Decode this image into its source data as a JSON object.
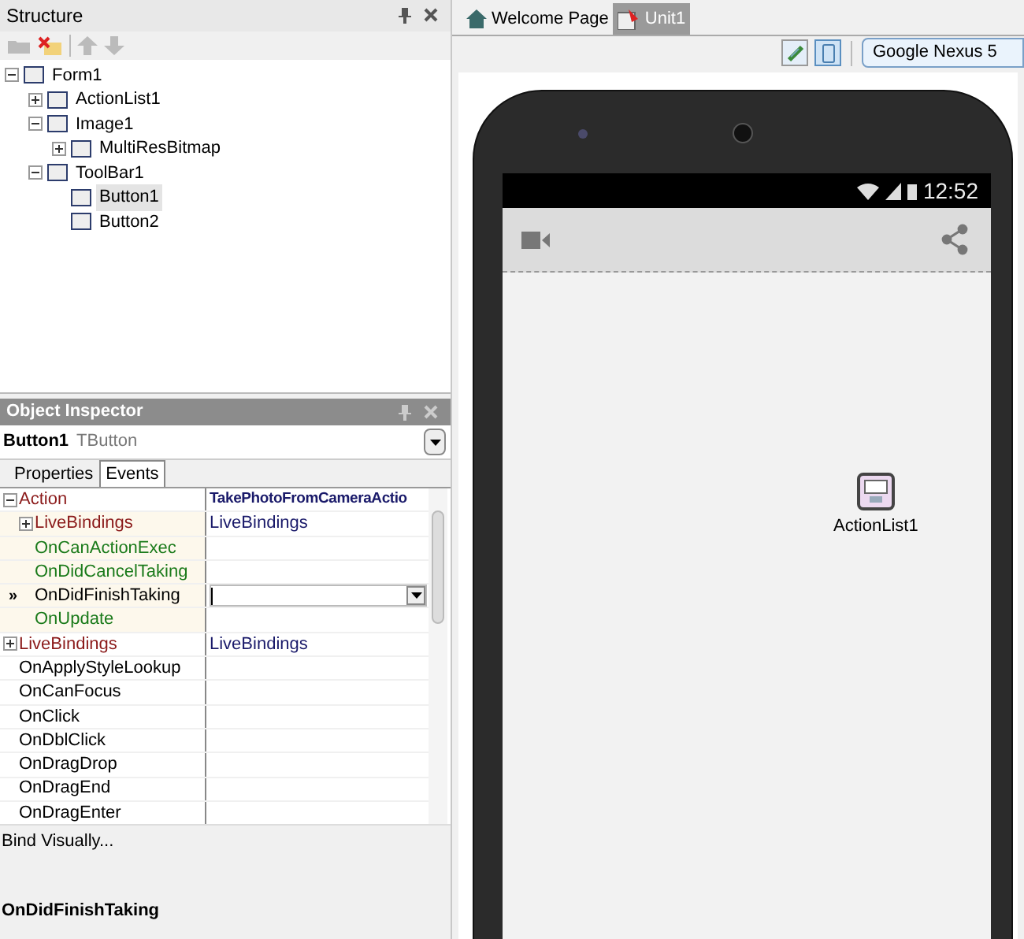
{
  "structure": {
    "title": "Structure",
    "tree": [
      {
        "label": "Form1",
        "expanded": true,
        "selected": false,
        "children": [
          {
            "label": "ActionList1",
            "expanded": false,
            "selected": false
          },
          {
            "label": "Image1",
            "expanded": true,
            "selected": false,
            "children": [
              {
                "label": "MultiResBitmap",
                "expanded": false,
                "selected": false
              }
            ]
          },
          {
            "label": "ToolBar1",
            "expanded": true,
            "selected": false,
            "children": [
              {
                "label": "Button1",
                "selected": true
              },
              {
                "label": "Button2",
                "selected": false
              }
            ]
          }
        ]
      }
    ]
  },
  "inspector": {
    "title": "Object Inspector",
    "component": "Button1",
    "component_type": "TButton",
    "tabs": [
      {
        "label": "Properties",
        "selected": false
      },
      {
        "label": "Events",
        "selected": true
      }
    ],
    "rows": [
      {
        "name": "Action",
        "kind": "category",
        "value": "TakePhotoFromCameraActio",
        "expanded": true,
        "selected": false,
        "children": [
          {
            "name": "LiveBindings",
            "kind": "category",
            "value": "LiveBindings",
            "expanded": false,
            "selected": false
          },
          {
            "name": "OnCanActionExec",
            "kind": "linked",
            "selected": false
          },
          {
            "name": "OnDidCancelTaking",
            "kind": "linked",
            "selected": false
          },
          {
            "name": "OnDidFinishTaking",
            "kind": "event",
            "selected": true
          },
          {
            "name": "OnUpdate",
            "kind": "linked",
            "selected": false
          }
        ]
      },
      {
        "name": "LiveBindings",
        "kind": "category",
        "value": "LiveBindings",
        "expanded": false,
        "selected": false
      },
      {
        "name": "OnApplyStyleLookup",
        "kind": "event",
        "selected": false
      },
      {
        "name": "OnCanFocus",
        "kind": "event",
        "selected": false
      },
      {
        "name": "OnClick",
        "kind": "event",
        "selected": false
      },
      {
        "name": "OnDblClick",
        "kind": "event",
        "selected": false
      },
      {
        "name": "OnDragDrop",
        "kind": "event",
        "selected": false
      },
      {
        "name": "OnDragEnd",
        "kind": "event",
        "selected": false
      },
      {
        "name": "OnDragEnter",
        "kind": "event",
        "selected": false
      }
    ],
    "selection_marker": "»",
    "link": "Bind Visually...",
    "selected_event": "OnDidFinishTaking"
  },
  "editor": {
    "tabs": [
      {
        "label": "Welcome Page",
        "kind": "home",
        "selected": false
      },
      {
        "label": "Unit1",
        "kind": "unit",
        "selected": true
      }
    ],
    "device": "Google Nexus 5",
    "phone": {
      "time": "12:52"
    },
    "components": [
      {
        "label": "ActionList1"
      }
    ]
  }
}
